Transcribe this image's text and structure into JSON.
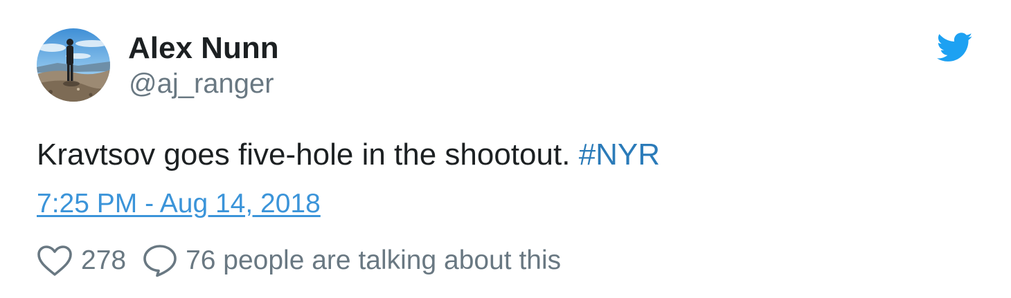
{
  "author": {
    "display_name": "Alex Nunn",
    "handle": "@aj_ranger",
    "avatar_icon": "profile-photo"
  },
  "brand": {
    "icon": "twitter-bird-icon",
    "color": "#1da1f2"
  },
  "tweet": {
    "text": "Kravtsov goes five-hole in the shootout. ",
    "hashtag": "#NYR",
    "timestamp": "7:25 PM - Aug 14, 2018"
  },
  "actions": {
    "like_icon": "heart-icon",
    "like_count": "278",
    "reply_icon": "speech-bubble-icon",
    "conversation_label": "76 people are talking about this"
  },
  "colors": {
    "text": "#1c2022",
    "secondary": "#697882",
    "link": "#3b94d9",
    "hashtag": "#2b7bb9"
  }
}
